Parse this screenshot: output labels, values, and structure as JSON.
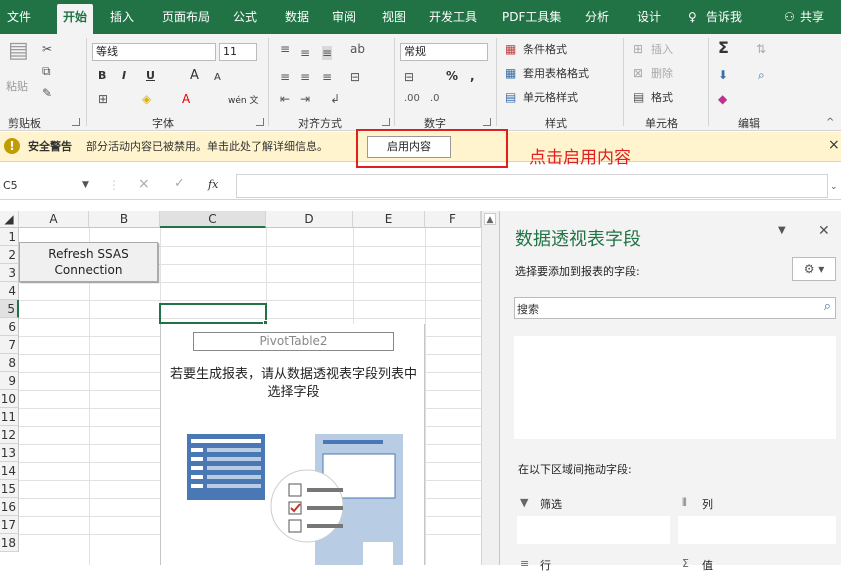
{
  "ribbon_tabs": [
    "文件",
    "开始",
    "插入",
    "页面布局",
    "公式",
    "数据",
    "审阅",
    "视图",
    "开发工具",
    "PDF工具集",
    "分析",
    "设计",
    "告诉我",
    "共享"
  ],
  "ribbon": {
    "clipboard": {
      "paste": "粘贴",
      "group": "剪贴板"
    },
    "font": {
      "name": "等线",
      "size": "11",
      "bold": "B",
      "italic": "I",
      "underline": "U",
      "grow": "A",
      "shrink": "A",
      "wen": "wén 文",
      "group": "字体"
    },
    "alignment": {
      "group": "对齐方式"
    },
    "number": {
      "format": "常规",
      "percent": "%",
      "comma": ",",
      "group": "数字"
    },
    "styles": {
      "conditional": "条件格式",
      "table": "套用表格格式",
      "cell": "单元格样式",
      "group": "样式"
    },
    "cells": {
      "insert": "插入",
      "delete": "删除",
      "format": "格式",
      "group": "单元格"
    },
    "editing": {
      "sum": "Σ",
      "group": "编辑"
    }
  },
  "security": {
    "title": "安全警告",
    "message": "部分活动内容已被禁用。单击此处了解详细信息。",
    "button": "启用内容",
    "close": "×"
  },
  "annotation": "点击启用内容",
  "formula_bar": {
    "namebox": "C5",
    "cancel": "×",
    "enter": "✓",
    "fx": "fx",
    "value": ""
  },
  "grid": {
    "columns": [
      "A",
      "B",
      "C",
      "D",
      "E",
      "F"
    ],
    "rows": [
      "1",
      "2",
      "3",
      "4",
      "5",
      "6",
      "7",
      "8",
      "9",
      "10",
      "11",
      "12",
      "13",
      "14",
      "15",
      "16",
      "17",
      "18"
    ],
    "refresh_button_line1": "Refresh SSAS",
    "refresh_button_line2": "Connection",
    "pivot_name": "PivotTable2",
    "pivot_hint": "若要生成报表，请从数据透视表字段列表中选择字段"
  },
  "pivot_panel": {
    "title": "数据透视表字段",
    "subtitle": "选择要添加到报表的字段:",
    "search_placeholder": "搜索",
    "drag_label": "在以下区域间拖动字段:",
    "filter": "筛选",
    "columns": "列",
    "rows": "行",
    "values": "值"
  }
}
